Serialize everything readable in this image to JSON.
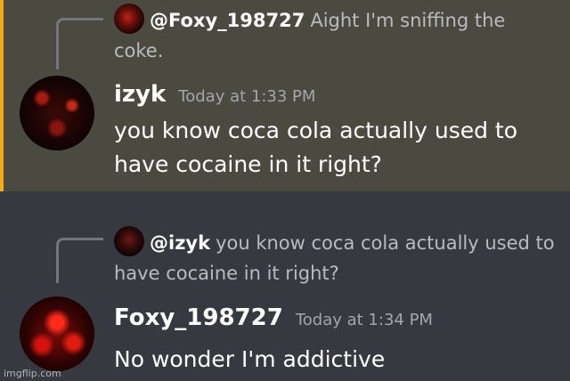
{
  "messages": [
    {
      "reply": {
        "name": "@Foxy_198727",
        "text": "Aight I'm sniffing the coke."
      },
      "author": "izyk",
      "timestamp": "Today at 1:33 PM",
      "content": "you know coca cola actually used to have cocaine in it right?",
      "highlighted": true,
      "accent_color": "#f4a81a"
    },
    {
      "reply": {
        "name": "@izyk",
        "text": "you know coca cola actually used to have cocaine in it right?"
      },
      "author": "Foxy_198727",
      "timestamp": "Today at 1:34 PM",
      "content": "No wonder I'm addictive",
      "highlighted": false
    }
  ],
  "watermark": "imgflip.com"
}
